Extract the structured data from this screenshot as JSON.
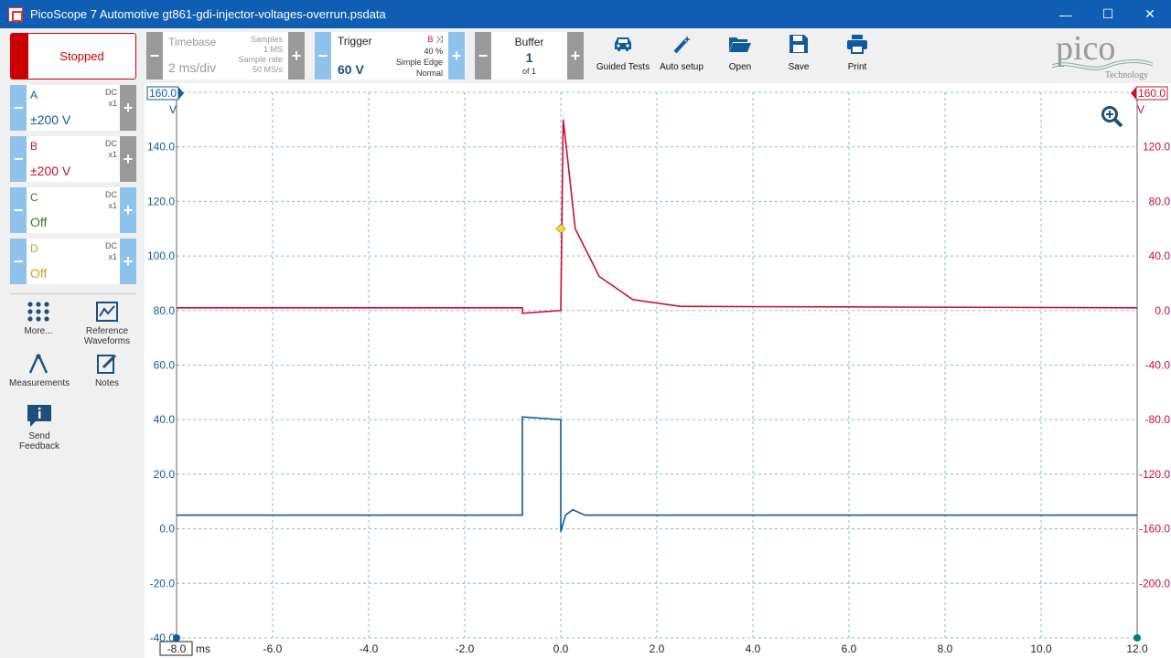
{
  "window": {
    "title": "PicoScope 7 Automotive gt861-gdi-injector-voltages-overrun.psdata"
  },
  "status": {
    "label": "Stopped"
  },
  "timebase": {
    "title": "Timebase",
    "value": "2 ms/div",
    "samples_label": "Samples",
    "samples_value": "1 MS",
    "rate_label": "Sample rate",
    "rate_value": "50 MS/s"
  },
  "trigger": {
    "title": "Trigger",
    "value": "60 V",
    "channel": "B",
    "percent": "40 %",
    "type": "Simple Edge",
    "mode": "Normal"
  },
  "buffer": {
    "title": "Buffer",
    "value": "1",
    "of": "of 1"
  },
  "toolbar": {
    "guided": "Guided Tests",
    "autosetup": "Auto setup",
    "open": "Open",
    "save": "Save",
    "print": "Print"
  },
  "logo": {
    "text": "pico",
    "sub": "Technology"
  },
  "channels": [
    {
      "name": "A",
      "coupling": "DC",
      "probe": "x1",
      "range": "±200 V",
      "color": "#0f5b9e"
    },
    {
      "name": "B",
      "coupling": "DC",
      "probe": "x1",
      "range": "±200 V",
      "color": "#c8102e"
    },
    {
      "name": "C",
      "coupling": "DC",
      "probe": "x1",
      "range": "Off",
      "color": "#2e7d32"
    },
    {
      "name": "D",
      "coupling": "DC",
      "probe": "x1",
      "range": "Off",
      "color": "#c9a227"
    }
  ],
  "tools": {
    "more": "More...",
    "reference": "Reference Waveforms",
    "measurements": "Measurements",
    "notes": "Notes",
    "feedback": "Send Feedback"
  },
  "chart_data": {
    "type": "line",
    "x_unit": "ms",
    "x_ticks": [
      "-8.0",
      "-6.0",
      "-4.0",
      "-2.0",
      "0.0",
      "2.0",
      "4.0",
      "6.0",
      "8.0",
      "10.0",
      "12.0"
    ],
    "xlim": [
      -8,
      12
    ],
    "y_left_label": "V",
    "y_left_ticks": [
      "-40.0",
      "-20.0",
      "0.0",
      "20.0",
      "40.0",
      "60.0",
      "80.0",
      "100.0",
      "120.0",
      "140.0"
    ],
    "y_left_max": "160.0",
    "ylim_left": [
      -40,
      160
    ],
    "y_right_label": "V",
    "y_right_ticks": [
      "-200.0",
      "-160.0",
      "-120.0",
      "-80.0",
      "-40.0",
      "0.0",
      "40.0",
      "80.0",
      "120.0"
    ],
    "y_right_max": "160.0",
    "ylim_right": [
      -240,
      160
    ],
    "series": [
      {
        "name": "A",
        "color": "#0f5b9e",
        "axis": "left",
        "points": [
          [
            -8,
            5
          ],
          [
            -0.8,
            5
          ],
          [
            -0.8,
            41
          ],
          [
            0,
            40
          ],
          [
            0,
            -1
          ],
          [
            0.1,
            5
          ],
          [
            0.25,
            7
          ],
          [
            0.5,
            5
          ],
          [
            12,
            5
          ]
        ]
      },
      {
        "name": "B",
        "color": "#c8102e",
        "axis": "right",
        "points": [
          [
            -8,
            2
          ],
          [
            -0.8,
            2
          ],
          [
            -0.8,
            -2
          ],
          [
            0,
            0
          ],
          [
            0.05,
            140
          ],
          [
            0.1,
            125
          ],
          [
            0.3,
            60
          ],
          [
            0.8,
            25
          ],
          [
            1.5,
            8
          ],
          [
            2.5,
            3
          ],
          [
            12,
            2
          ]
        ]
      }
    ],
    "trigger_point": [
      0,
      60
    ]
  }
}
